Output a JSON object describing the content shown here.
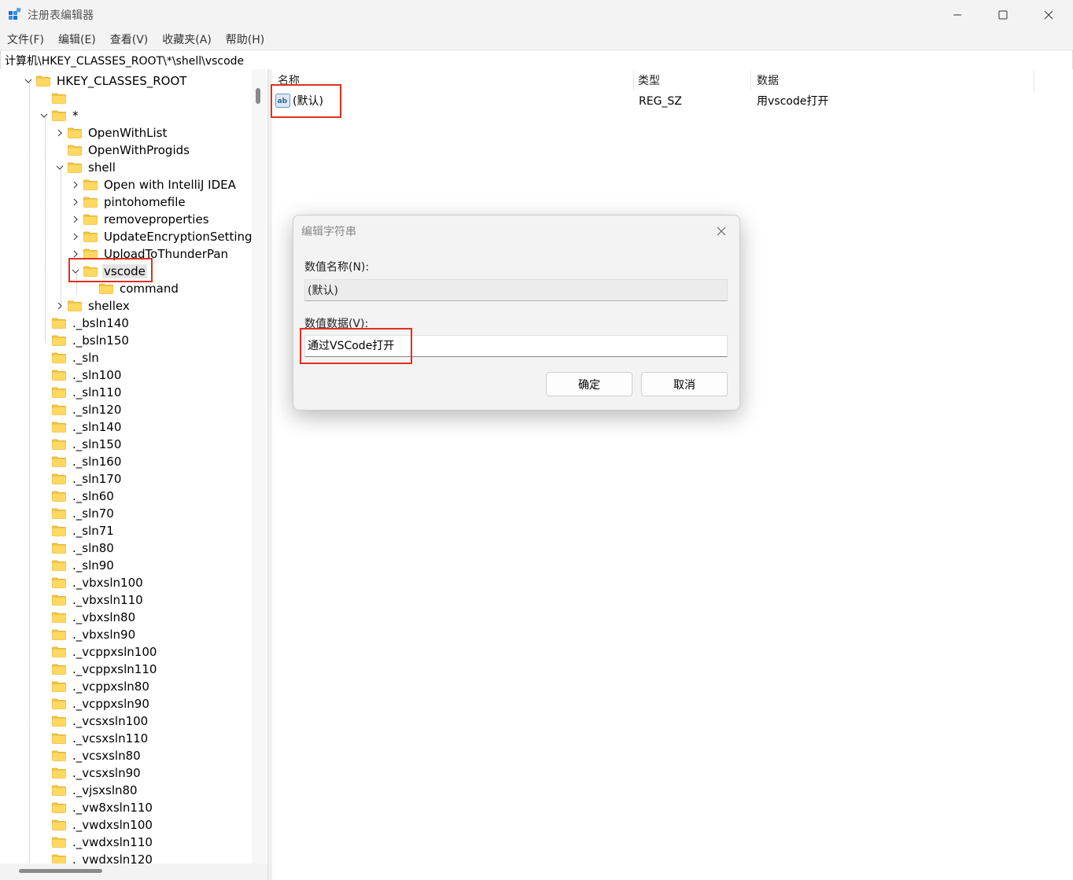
{
  "window": {
    "title": "注册表编辑器"
  },
  "menu": [
    "文件(F)",
    "编辑(E)",
    "查看(V)",
    "收藏夹(A)",
    "帮助(H)"
  ],
  "address": "计算机\\HKEY_CLASSES_ROOT\\*\\shell\\vscode",
  "tree": [
    {
      "label": "HKEY_CLASSES_ROOT",
      "depth": 0,
      "expander": "open"
    },
    {
      "label": "",
      "depth": 1,
      "expander": "none"
    },
    {
      "label": "*",
      "depth": 1,
      "expander": "open"
    },
    {
      "label": "OpenWithList",
      "depth": 2,
      "expander": "closed"
    },
    {
      "label": "OpenWithProgids",
      "depth": 2,
      "expander": "none"
    },
    {
      "label": "shell",
      "depth": 2,
      "expander": "open"
    },
    {
      "label": "Open with IntelliJ IDEA",
      "depth": 3,
      "expander": "closed"
    },
    {
      "label": "pintohomefile",
      "depth": 3,
      "expander": "closed"
    },
    {
      "label": "removeproperties",
      "depth": 3,
      "expander": "closed"
    },
    {
      "label": "UpdateEncryptionSetting",
      "depth": 3,
      "expander": "closed"
    },
    {
      "label": "UploadToThunderPan",
      "depth": 3,
      "expander": "closed"
    },
    {
      "label": "vscode",
      "depth": 3,
      "expander": "open",
      "selected": true
    },
    {
      "label": "command",
      "depth": 4,
      "expander": "none"
    },
    {
      "label": "shellex",
      "depth": 2,
      "expander": "closed"
    },
    {
      "label": "._bsln140",
      "depth": 1,
      "expander": "none"
    },
    {
      "label": "._bsln150",
      "depth": 1,
      "expander": "none"
    },
    {
      "label": "._sln",
      "depth": 1,
      "expander": "none"
    },
    {
      "label": "._sln100",
      "depth": 1,
      "expander": "none"
    },
    {
      "label": "._sln110",
      "depth": 1,
      "expander": "none"
    },
    {
      "label": "._sln120",
      "depth": 1,
      "expander": "none"
    },
    {
      "label": "._sln140",
      "depth": 1,
      "expander": "none"
    },
    {
      "label": "._sln150",
      "depth": 1,
      "expander": "none"
    },
    {
      "label": "._sln160",
      "depth": 1,
      "expander": "none"
    },
    {
      "label": "._sln170",
      "depth": 1,
      "expander": "none"
    },
    {
      "label": "._sln60",
      "depth": 1,
      "expander": "none"
    },
    {
      "label": "._sln70",
      "depth": 1,
      "expander": "none"
    },
    {
      "label": "._sln71",
      "depth": 1,
      "expander": "none"
    },
    {
      "label": "._sln80",
      "depth": 1,
      "expander": "none"
    },
    {
      "label": "._sln90",
      "depth": 1,
      "expander": "none"
    },
    {
      "label": "._vbxsln100",
      "depth": 1,
      "expander": "none"
    },
    {
      "label": "._vbxsln110",
      "depth": 1,
      "expander": "none"
    },
    {
      "label": "._vbxsln80",
      "depth": 1,
      "expander": "none"
    },
    {
      "label": "._vbxsln90",
      "depth": 1,
      "expander": "none"
    },
    {
      "label": "._vcppxsln100",
      "depth": 1,
      "expander": "none"
    },
    {
      "label": "._vcppxsln110",
      "depth": 1,
      "expander": "none"
    },
    {
      "label": "._vcppxsln80",
      "depth": 1,
      "expander": "none"
    },
    {
      "label": "._vcppxsln90",
      "depth": 1,
      "expander": "none"
    },
    {
      "label": "._vcsxsln100",
      "depth": 1,
      "expander": "none"
    },
    {
      "label": "._vcsxsln110",
      "depth": 1,
      "expander": "none"
    },
    {
      "label": "._vcsxsln80",
      "depth": 1,
      "expander": "none"
    },
    {
      "label": "._vcsxsln90",
      "depth": 1,
      "expander": "none"
    },
    {
      "label": "._vjsxsln80",
      "depth": 1,
      "expander": "none"
    },
    {
      "label": "._vw8xsln110",
      "depth": 1,
      "expander": "none"
    },
    {
      "label": "._vwdxsln100",
      "depth": 1,
      "expander": "none"
    },
    {
      "label": "._vwdxsln110",
      "depth": 1,
      "expander": "none"
    },
    {
      "label": "._vwdxsln120",
      "depth": 1,
      "expander": "none"
    }
  ],
  "list": {
    "columns": [
      "名称",
      "类型",
      "数据"
    ],
    "rows": [
      {
        "name": "(默认)",
        "type": "REG_SZ",
        "data": "用vscode打开",
        "icon": "string-value-icon"
      }
    ]
  },
  "dialog": {
    "title": "编辑字符串",
    "name_label": "数值名称(N):",
    "name_value": "(默认)",
    "data_label": "数值数据(V):",
    "data_value": "通过VSCode打开",
    "ok": "确定",
    "cancel": "取消"
  },
  "colors": {
    "annotation": "#e0301e",
    "folder": "#f5c842",
    "selection": "#e5e5e5"
  }
}
